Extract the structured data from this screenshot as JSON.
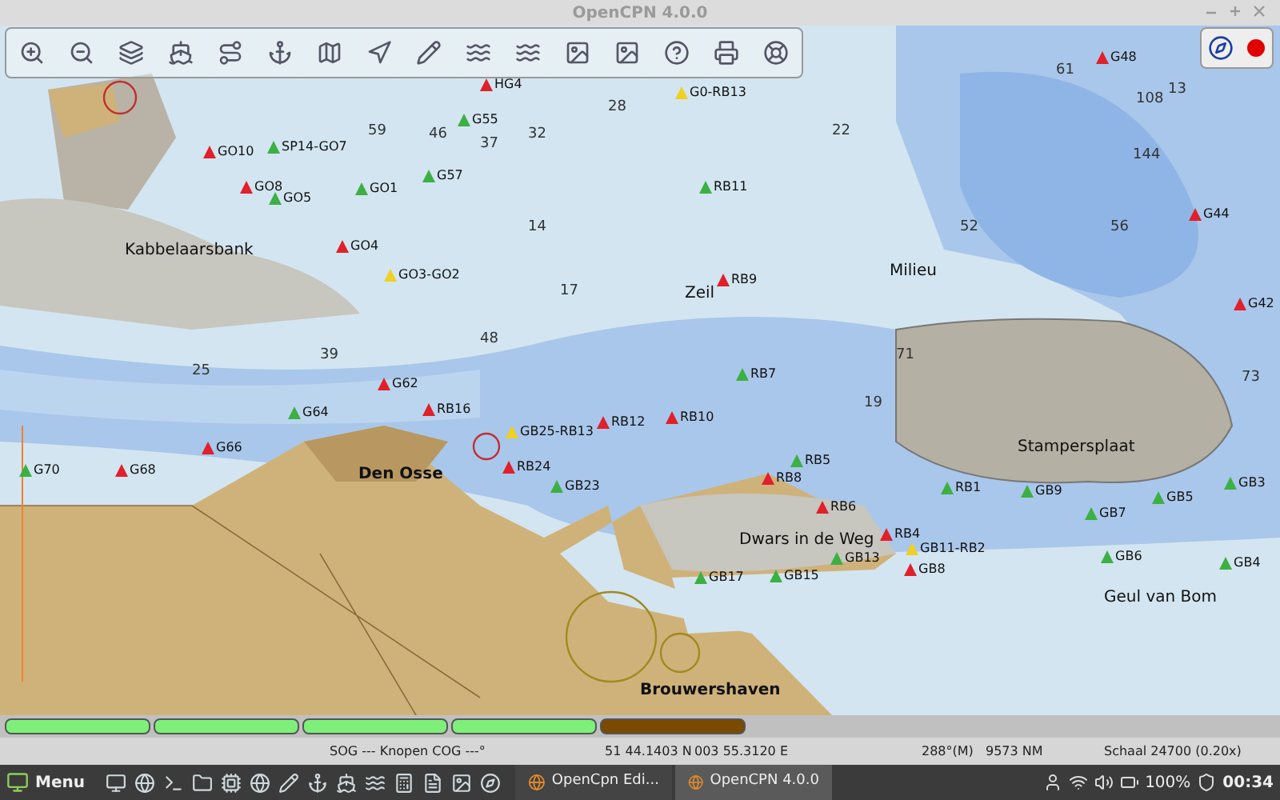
{
  "window": {
    "title": "OpenCPN 4.0.0"
  },
  "chart": {
    "places": [
      "Kabbelaarsbank",
      "Den Osse",
      "Stampersplaat",
      "Dwars in de Weg",
      "Brouwershaven",
      "Geul van Bom",
      "Zeil",
      "Milieu"
    ],
    "buoys": [
      {
        "label": "GO10",
        "color": "#e0202a"
      },
      {
        "label": "GO8",
        "color": "#e0202a"
      },
      {
        "label": "SP14-GO7",
        "color": "#3cb043"
      },
      {
        "label": "GO5",
        "color": "#3cb043"
      },
      {
        "label": "GO1",
        "color": "#3cb043"
      },
      {
        "label": "GO4",
        "color": "#e0202a"
      },
      {
        "label": "GO3-GO2",
        "color": "#f0d020"
      },
      {
        "label": "G55",
        "color": "#3cb043"
      },
      {
        "label": "G57",
        "color": "#3cb043"
      },
      {
        "label": "G0-RB13",
        "color": "#f0d020"
      },
      {
        "label": "HG4",
        "color": "#e0202a"
      },
      {
        "label": "RB11",
        "color": "#3cb043"
      },
      {
        "label": "RB9",
        "color": "#e0202a"
      },
      {
        "label": "RB7",
        "color": "#3cb043"
      },
      {
        "label": "RB12",
        "color": "#e0202a"
      },
      {
        "label": "RB10",
        "color": "#e0202a"
      },
      {
        "label": "RB16",
        "color": "#e0202a"
      },
      {
        "label": "RB24",
        "color": "#e0202a"
      },
      {
        "label": "GB25-RB13",
        "color": "#f0d020"
      },
      {
        "label": "GB23",
        "color": "#3cb043"
      },
      {
        "label": "RB5",
        "color": "#3cb043"
      },
      {
        "label": "RB8",
        "color": "#e0202a"
      },
      {
        "label": "RB6",
        "color": "#e0202a"
      },
      {
        "label": "RB4",
        "color": "#e0202a"
      },
      {
        "label": "RB1",
        "color": "#3cb043"
      },
      {
        "label": "GB9",
        "color": "#3cb043"
      },
      {
        "label": "GB7",
        "color": "#3cb043"
      },
      {
        "label": "GB5",
        "color": "#3cb043"
      },
      {
        "label": "GB3",
        "color": "#3cb043"
      },
      {
        "label": "GB6",
        "color": "#3cb043"
      },
      {
        "label": "GB4",
        "color": "#3cb043"
      },
      {
        "label": "GB11-RB2",
        "color": "#f0d020"
      },
      {
        "label": "GB8",
        "color": "#e0202a"
      },
      {
        "label": "GB13",
        "color": "#3cb043"
      },
      {
        "label": "GB15",
        "color": "#3cb043"
      },
      {
        "label": "GB17",
        "color": "#3cb043"
      },
      {
        "label": "G64",
        "color": "#3cb043"
      },
      {
        "label": "G66",
        "color": "#e0202a"
      },
      {
        "label": "G70",
        "color": "#3cb043"
      },
      {
        "label": "G68",
        "color": "#e0202a"
      },
      {
        "label": "G62",
        "color": "#e0202a"
      },
      {
        "label": "G48",
        "color": "#e0202a"
      },
      {
        "label": "G44",
        "color": "#e0202a"
      },
      {
        "label": "G42",
        "color": "#e0202a"
      }
    ],
    "soundings": [
      "59",
      "46",
      "37",
      "32",
      "28",
      "13",
      "108",
      "144",
      "56",
      "61",
      "14",
      "17",
      "19",
      "22",
      "71",
      "73",
      "52",
      "48",
      "39",
      "25"
    ]
  },
  "chart_bar": [
    {
      "selected": false
    },
    {
      "selected": false
    },
    {
      "selected": false
    },
    {
      "selected": false
    },
    {
      "selected": true
    }
  ],
  "status_bar": {
    "speed": "SOG --- Knopen COG ---°",
    "lat": "51 44.1403 N",
    "lon": "003 55.3120 E",
    "bearing": "288°(M)",
    "distance": "9573 NM",
    "scale": "Schaal 24700 (0.20x)"
  },
  "taskbar": {
    "menu": "Menu",
    "windows": [
      {
        "title": "OpenCpn Edi...",
        "selected": false
      },
      {
        "title": "OpenCPN 4.0.0",
        "selected": true
      }
    ],
    "battery": "100%",
    "clock": "00:34"
  }
}
